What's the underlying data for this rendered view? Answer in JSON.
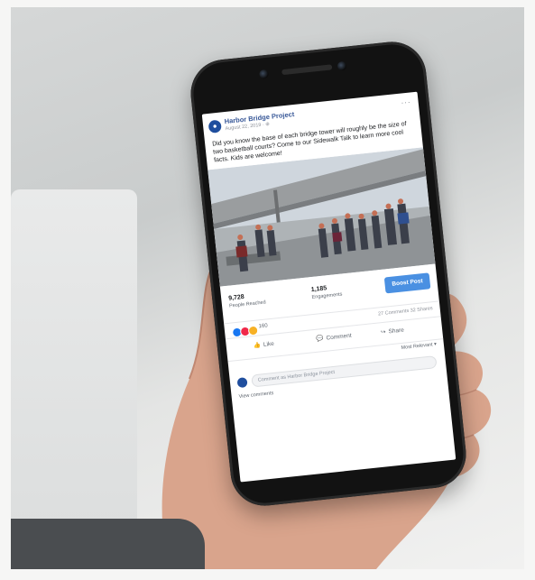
{
  "post": {
    "page_name": "Harbor Bridge Project",
    "date": "August 22, 2019 · ",
    "text": "Did you know the base of each bridge tower will roughly be the size of two basketball courts? Come to our Sidewalk Talk to learn more cool facts. Kids are welcome!",
    "more_icon": "more-dots-icon"
  },
  "stats": {
    "people_reached": "9,728",
    "people_reached_label": "People Reached",
    "engagements": "1,185",
    "engagements_label": "Engagements",
    "boost_label": "Boost Post"
  },
  "reactions": {
    "count": "160",
    "comments_shares": "27 Comments  32 Shares"
  },
  "actions": {
    "like": "Like",
    "comment": "Comment",
    "share": "Share"
  },
  "comments": {
    "sort_label": "Most Relevant ▾",
    "input_placeholder": "Comment as Harbor Bridge Project",
    "view_more": "View comments"
  },
  "colors": {
    "brand_blue": "#385898",
    "boost_blue": "#4a90e2",
    "phone_black": "#121212"
  }
}
